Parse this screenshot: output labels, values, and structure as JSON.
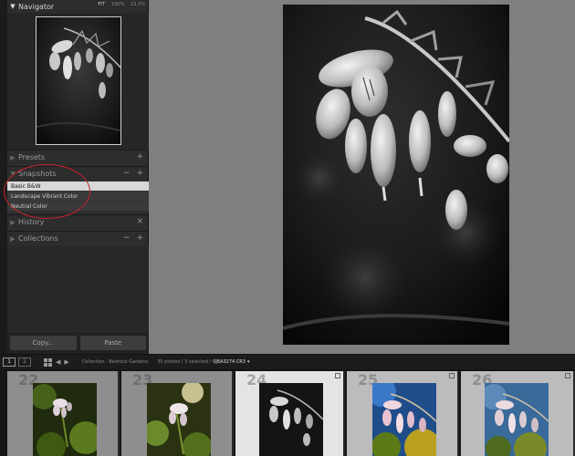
{
  "navigator": {
    "title": "Navigator",
    "zoom_options": [
      "FIT",
      "100%",
      "13.3%"
    ]
  },
  "presets": {
    "title": "Presets",
    "add": "+"
  },
  "snapshots": {
    "title": "Snapshots",
    "minus": "−",
    "add": "+",
    "items": [
      {
        "label": "Basic B&W",
        "selected": true
      },
      {
        "label": "Landscape Vibrant Color",
        "selected": false
      },
      {
        "label": "Neutral Color",
        "selected": false
      }
    ]
  },
  "history": {
    "title": "History",
    "clear": "×"
  },
  "collections": {
    "title": "Collections",
    "minus": "−",
    "add": "+"
  },
  "buttons": {
    "copy": "Copy...",
    "paste": "Paste"
  },
  "filmbar": {
    "screen1": "1",
    "screen2": "2",
    "collection_text": "Collection : Bedrock Gardens",
    "count_text": "35 photos / 3 selected /",
    "filename": "0J8A3274.CR3",
    "dropdown": "▾"
  },
  "filmstrip": {
    "cells": [
      {
        "number": "22",
        "state": "normal"
      },
      {
        "number": "23",
        "state": "normal"
      },
      {
        "number": "24",
        "state": "active"
      },
      {
        "number": "25",
        "state": "selected"
      },
      {
        "number": "26",
        "state": "selected"
      }
    ]
  },
  "colors": {
    "annotation_circle": "#c8242c",
    "panel_bg": "#2d2d2d",
    "main_bg": "#7f7f7f"
  }
}
